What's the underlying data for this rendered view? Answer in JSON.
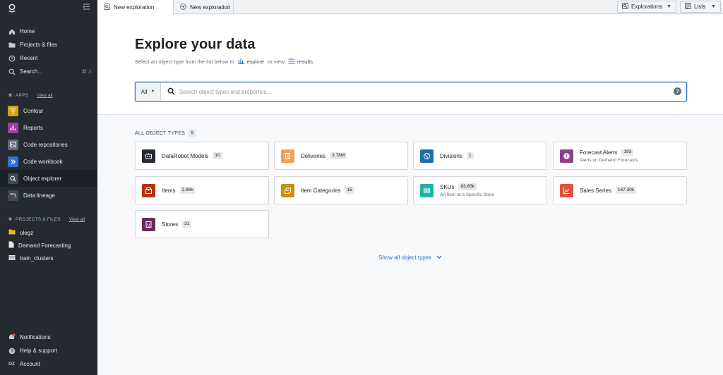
{
  "sidebar": {
    "nav": [
      {
        "label": "Home",
        "icon": "home-icon"
      },
      {
        "label": "Projects & files",
        "icon": "folder-icon"
      },
      {
        "label": "Recent",
        "icon": "history-icon"
      },
      {
        "label": "Search...",
        "icon": "search-icon",
        "shortcut": "⌘ J"
      }
    ],
    "apps_header": "APPS",
    "apps_view_all": "View all",
    "apps": [
      {
        "label": "Contour",
        "icon": "contour-icon",
        "color": "#d99e0b"
      },
      {
        "label": "Reports",
        "icon": "reports-icon",
        "color": "#9d3f9d"
      },
      {
        "label": "Code repositories",
        "icon": "code-repo-icon",
        "color": "#5f6b7c"
      },
      {
        "label": "Code workbook",
        "icon": "code-workbook-icon",
        "color": "#2d72d2"
      },
      {
        "label": "Object explorer",
        "icon": "object-explorer-icon",
        "color": "#404854",
        "active": true
      },
      {
        "label": "Data lineage",
        "icon": "data-lineage-icon",
        "color": "#d99e0b"
      }
    ],
    "projects_header": "PROJECTS & FILES",
    "projects_view_all": "View all",
    "projects": [
      {
        "label": "olegz",
        "icon": "folder-icon"
      },
      {
        "label": "Demand Forecasting",
        "icon": "document-icon"
      },
      {
        "label": "train_clusters",
        "icon": "dataset-icon"
      }
    ],
    "bottom": [
      {
        "label": "Notifications",
        "icon": "notifications-icon"
      },
      {
        "label": "Help & support",
        "icon": "help-icon"
      },
      {
        "label": "Account",
        "icon": "account-icon",
        "initials": "OZ"
      }
    ]
  },
  "tabs": [
    {
      "label": "New exploration"
    },
    {
      "label": "New exploration"
    }
  ],
  "toolbar": {
    "explorations_label": "Explorations",
    "lists_label": "Lists"
  },
  "header": {
    "title": "Explore your data",
    "subtitle_pre": "Select an object type from the list below to",
    "explore_label": "explore",
    "or_view": "or view",
    "results_label": "results"
  },
  "search": {
    "scope": "All",
    "placeholder": "Search object types and properties..."
  },
  "object_types": {
    "header": "ALL OBJECT TYPES",
    "count": "9",
    "items": [
      {
        "name": "DataRobot Models",
        "count": "10",
        "desc": "",
        "color": "#252a31"
      },
      {
        "name": "Deliveries",
        "count": "3.78M",
        "desc": "",
        "color": "#f0a15a"
      },
      {
        "name": "Divisions",
        "count": "1",
        "desc": "",
        "color": "#1f6fa3"
      },
      {
        "name": "Forecast Alerts",
        "count": "193",
        "desc": "Alerts on Demand Forecasts",
        "color": "#8f3f8f"
      },
      {
        "name": "Items",
        "count": "2.98k",
        "desc": "",
        "color": "#b83211"
      },
      {
        "name": "Item Categories",
        "count": "15",
        "desc": "",
        "color": "#c8920a"
      },
      {
        "name": "SKUs",
        "count": "83.65k",
        "desc": "An Item at a Specific Store",
        "color": "#1fb5a5"
      },
      {
        "name": "Sales Series",
        "count": "167.30k",
        "desc": "",
        "color": "#e0533a"
      },
      {
        "name": "Stores",
        "count": "31",
        "desc": "",
        "color": "#6b2a5f"
      }
    ]
  },
  "show_all_label": "Show all object types"
}
